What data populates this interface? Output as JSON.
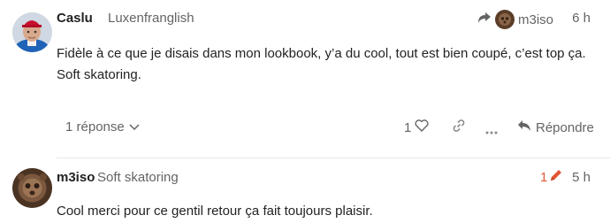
{
  "posts": [
    {
      "username": "Caslu",
      "user_title": "Luxenfranglish",
      "reply_to": {
        "username": "m3iso"
      },
      "date": "6 h",
      "body": "Fidèle à ce que je disais dans mon lookbook, y’a du cool, tout est bien coupé, c’est top ça. Soft skatoring.",
      "replies_label": "1 réponse",
      "like_count": "1",
      "reply_label": "Répondre"
    },
    {
      "username": "m3iso",
      "user_title": "Soft skatoring",
      "edit_count": "1",
      "date": "5 h",
      "body": "Cool merci pour ce gentil retour ça fait toujours plaisir."
    }
  ],
  "colors": {
    "text_primary": "#222222",
    "text_muted": "#646464",
    "edit_accent": "#e45735",
    "divider": "#e9e9e9"
  },
  "icons": [
    "reply-arrow-icon",
    "chevron-down-icon",
    "heart-icon",
    "link-icon",
    "ellipsis-icon",
    "reply-icon",
    "pencil-icon"
  ]
}
